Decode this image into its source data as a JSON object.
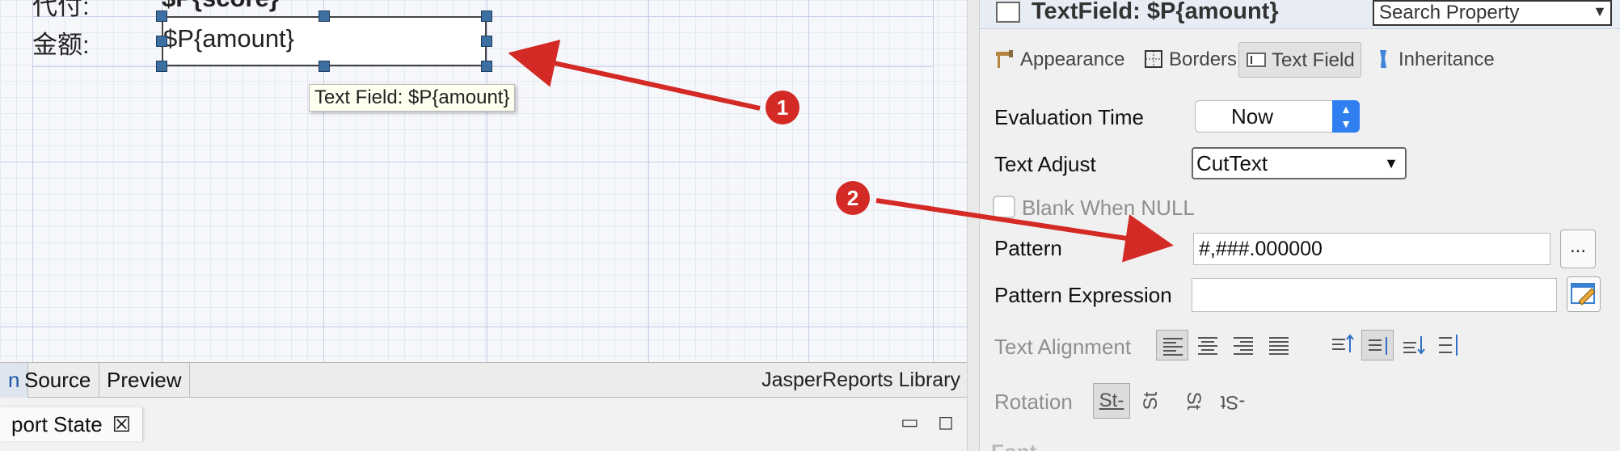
{
  "canvas": {
    "top_row_label": "代付:",
    "top_row_value": "$P{score}",
    "amount_label": "金额:",
    "textfield_expression": "$P{amount}",
    "tooltip": "Text Field: $P{amount}"
  },
  "design_tabs": {
    "tabs": [
      {
        "label": "n"
      },
      {
        "label": "Source"
      },
      {
        "label": "Preview"
      }
    ],
    "library_label": "JasperReports Library"
  },
  "report_state": {
    "tab_label": "port State",
    "close_glyph": "☒",
    "minimize_glyph": "▭",
    "maximize_glyph": "◻"
  },
  "properties": {
    "title": "TextField: $P{amount}",
    "search_placeholder": "Search Property",
    "tabs": [
      {
        "label": "Appearance",
        "icon": "appearance-icon"
      },
      {
        "label": "Borders",
        "icon": "borders-icon"
      },
      {
        "label": "Text Field",
        "icon": "text-field-icon"
      },
      {
        "label": "Inheritance",
        "icon": "inheritance-icon"
      }
    ],
    "evaluation_time_label": "Evaluation Time",
    "evaluation_time_value": "Now",
    "text_adjust_label": "Text Adjust",
    "text_adjust_value": "CutText",
    "blank_when_null_label": "Blank When NULL",
    "pattern_label": "Pattern",
    "pattern_value": "#,###.000000",
    "pattern_button": "...",
    "pattern_expression_label": "Pattern Expression",
    "pattern_expression_value": "",
    "text_alignment_label": "Text Alignment",
    "rotation_label": "Rotation",
    "rotation_options": [
      "St-",
      "St",
      "St",
      "-St"
    ],
    "font_section": "Font"
  },
  "annotations": {
    "badge_1": "1",
    "badge_2": "2",
    "accent_color": "#d42a25"
  }
}
